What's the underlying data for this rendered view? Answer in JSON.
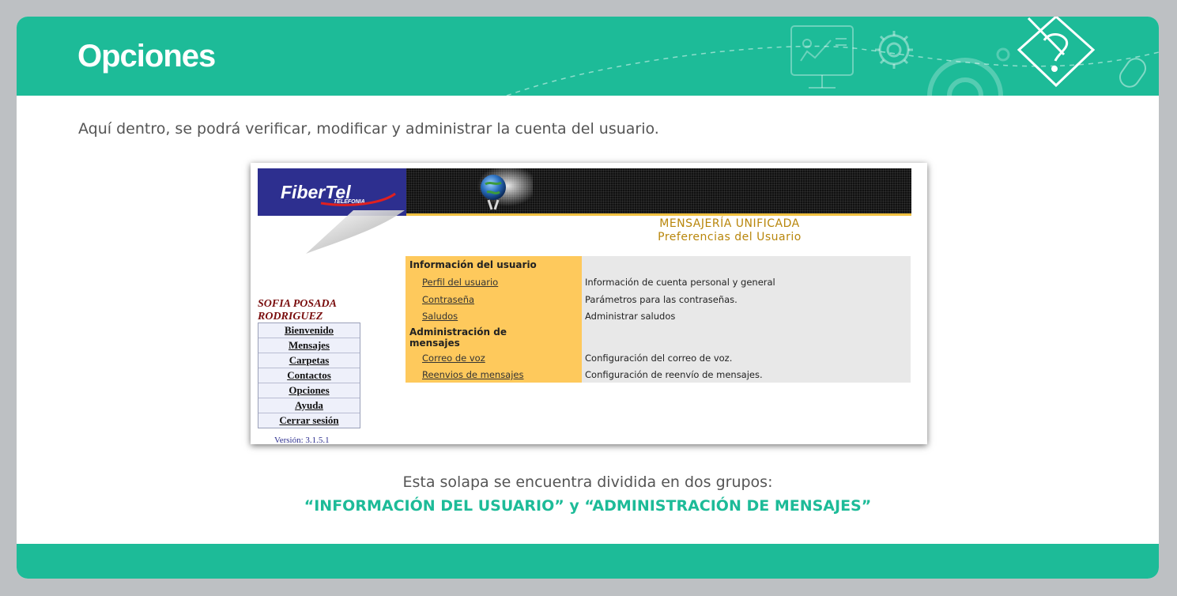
{
  "slide": {
    "title": "Opciones",
    "intro": "Aquí dentro, se podrá verificar, modificar y administrar la cuenta del usuario.",
    "caption_line1": "Esta solapa se encuentra dividida en dos grupos:",
    "caption_line2": "“INFORMACIÓN DEL USUARIO” y “ADMINISTRACIÓN DE MENSAJES”"
  },
  "app": {
    "logo": "FiberTel",
    "logo_sub": "TELEFONIA",
    "title_line1": "MENSAJERÍA UNIFICADA",
    "title_line2": "Preferencias del Usuario",
    "user_name_line1": "SOFIA POSADA",
    "user_name_line2": "RODRIGUEZ",
    "menu": [
      "Bienvenido",
      "Mensajes",
      "Carpetas",
      "Contactos",
      "Opciones",
      "Ayuda",
      "Cerrar sesión"
    ],
    "version": "Versión: 3.1.5.1",
    "groups": [
      {
        "title": "Información del usuario",
        "items": [
          {
            "link": "Perfil del usuario",
            "desc": "Información de cuenta personal y general"
          },
          {
            "link": "Contraseña",
            "desc": "Parámetros para las contraseñas."
          },
          {
            "link": "Saludos",
            "desc": "Administrar saludos"
          }
        ]
      },
      {
        "title_line1": "Administración de",
        "title_line2": "mensajes",
        "items": [
          {
            "link": "Correo de voz",
            "desc": "Configuración del correo de voz."
          },
          {
            "link": "Reenvios de mensajes",
            "desc": "Configuración de reenvío de mensajes."
          }
        ]
      }
    ]
  },
  "colors": {
    "accent": "#1dbb98",
    "options_panel": "#fec95c",
    "logo_blue": "#2d2f8f"
  },
  "icons": [
    "presentation-board-icon",
    "gear-icon",
    "settings-cog-icon",
    "mouse-icon",
    "pencil-puzzle-icon"
  ]
}
